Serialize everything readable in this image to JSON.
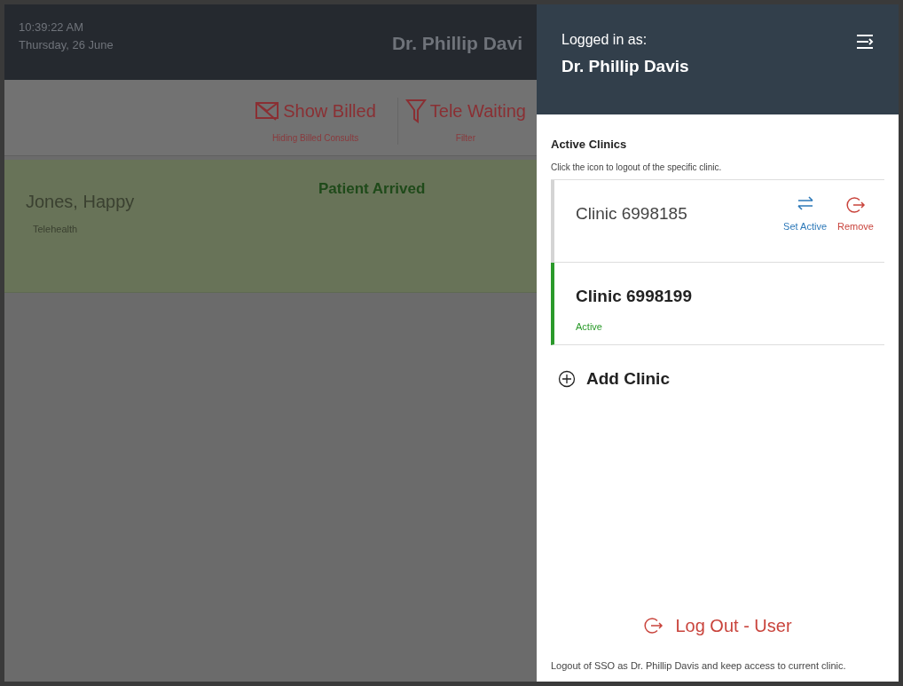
{
  "background": {
    "time": "10:39:22 AM",
    "date": "Thursday, 26 June",
    "doctor": "Dr. Phillip Davi",
    "toolbar": [
      {
        "kind": "billed",
        "label": "Show Billed",
        "caption": "Hiding Billed Consults"
      },
      {
        "kind": "filter",
        "label": "Tele Waiting",
        "caption": "Filter"
      }
    ],
    "patient": {
      "name": "Jones, Happy",
      "type": "Telehealth",
      "status": "Patient Arrived"
    }
  },
  "drawer": {
    "logged_in_label": "Logged in as:",
    "user": "Dr. Phillip Davis",
    "section_title": "Active Clinics",
    "hint": "Click the icon to logout of the specific clinic.",
    "clinics": [
      {
        "name": "Clinic 6998185",
        "selected": false,
        "set_active": "Set Active",
        "remove": "Remove"
      },
      {
        "name": "Clinic 6998199",
        "selected": true,
        "status": "Active"
      }
    ],
    "add_clinic": "Add Clinic",
    "logout": "Log Out - User",
    "logout_note": "Logout of SSO as Dr. Phillip Davis and keep access to current clinic."
  }
}
